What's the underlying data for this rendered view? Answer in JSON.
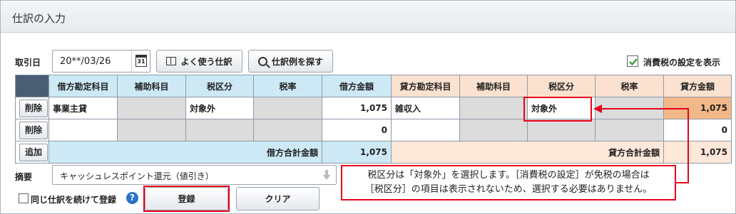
{
  "window": {
    "title": "仕訳の入力"
  },
  "date": {
    "label": "取引日",
    "value": "20**/03/26"
  },
  "toolbar": {
    "favorite_label": "よく使う仕訳",
    "examples_label": "仕訳例を探す",
    "show_tax_label": "消費税の設定を表示",
    "show_tax_checked": true
  },
  "table": {
    "headers": [
      "借方勘定科目",
      "補助科目",
      "税区分",
      "税率",
      "借方金額",
      "貸方勘定科目",
      "補助科目",
      "税区分",
      "税率",
      "貸方金額"
    ],
    "rows": [
      {
        "action": "削除",
        "debit_account": "事業主貸",
        "debit_sub": "",
        "debit_tax": "対象外",
        "debit_rate": "",
        "debit_amount": "1,075",
        "credit_account": "雑収入",
        "credit_sub": "",
        "credit_tax": "対象外",
        "credit_rate": "",
        "credit_amount": "1,075"
      },
      {
        "action": "削除",
        "debit_account": "",
        "debit_sub": "",
        "debit_tax": "",
        "debit_rate": "",
        "debit_amount": "0",
        "credit_account": "",
        "credit_sub": "",
        "credit_tax": "",
        "credit_rate": "",
        "credit_amount": "0"
      }
    ],
    "footer": {
      "add_label": "追加",
      "debit_total_label": "借方合計金額",
      "debit_total": "1,075",
      "credit_total_label": "貸方合計金額",
      "credit_total": "1,075"
    }
  },
  "memo": {
    "label": "摘要",
    "value": "キャッシュレスポイント還元（値引き）"
  },
  "footer": {
    "continue_label": "同じ仕訳を続けて登録",
    "continue_checked": false,
    "help_label": "?",
    "register_label": "登録",
    "clear_label": "クリア"
  },
  "annotation": {
    "line1": "税区分は「対象外」を選択します。［消費税の設定］が免税の場合は",
    "line2": "［税区分］の項目は表示されないため、選択する必要はありません。"
  },
  "colors": {
    "highlight": "#e8001c",
    "debit_bg": "#cde9f6",
    "credit_bg": "#fbe1cf",
    "accent": "#2b72c8"
  }
}
